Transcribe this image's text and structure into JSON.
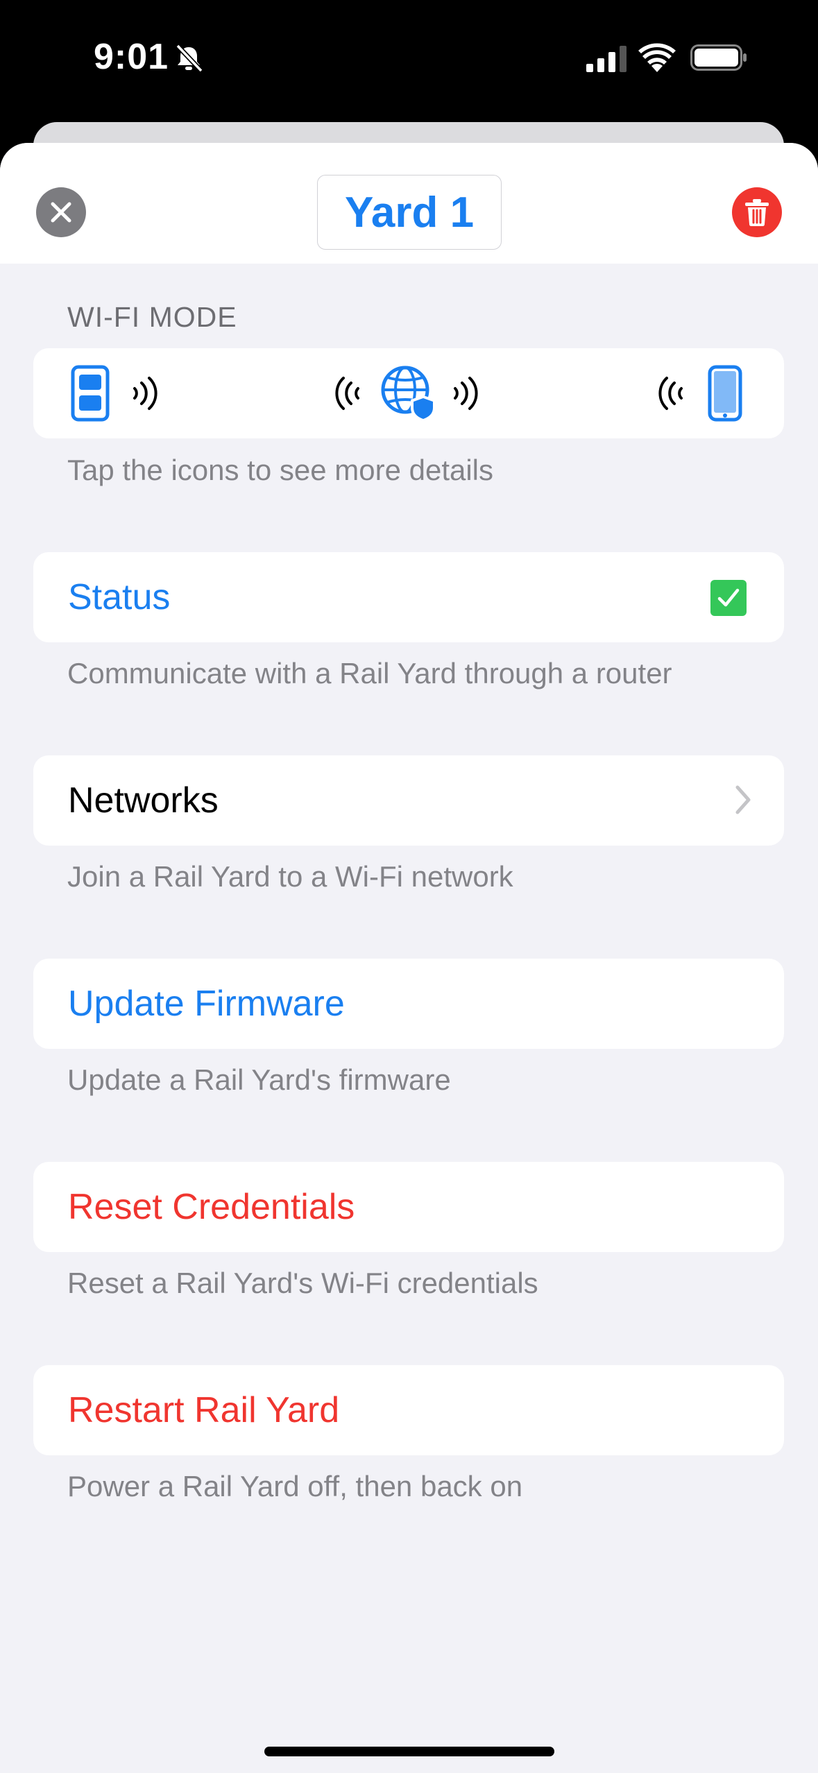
{
  "status_bar": {
    "time": "9:01",
    "icons": [
      "bell-slash-icon",
      "cellular-signal-icon",
      "wifi-icon",
      "battery-icon"
    ]
  },
  "navbar": {
    "title": "Yard 1",
    "close_icon": "xmark-icon",
    "delete_icon": "trash-icon"
  },
  "wifi_mode": {
    "header": "WI-FI MODE",
    "icons": [
      "rail-yard-device-icon",
      "broadcast-out-icon",
      "broadcast-in-icon",
      "globe-shield-icon",
      "broadcast-out-icon",
      "broadcast-in-icon",
      "phone-icon"
    ],
    "footer": "Tap the icons to see more details"
  },
  "status": {
    "label": "Status",
    "checked": true,
    "footer": "Communicate with a Rail Yard through a router"
  },
  "networks": {
    "label": "Networks",
    "footer": "Join a Rail Yard to a Wi-Fi network"
  },
  "update_firmware": {
    "label": "Update Firmware",
    "footer": "Update a Rail Yard's firmware"
  },
  "reset_credentials": {
    "label": "Reset Credentials",
    "footer": "Reset a Rail Yard's Wi-Fi credentials"
  },
  "restart": {
    "label": "Restart Rail Yard",
    "footer": "Power a Rail Yard off, then back on"
  },
  "colors": {
    "accent_blue": "#1a7ff0",
    "destructive_red": "#f0352f",
    "success_green": "#34c759",
    "background": "#f2f2f7"
  }
}
